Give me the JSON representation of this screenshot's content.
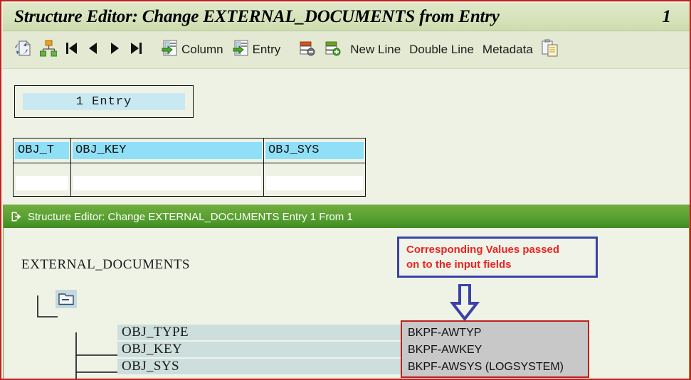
{
  "window": {
    "title": "Structure Editor: Change EXTERNAL_DOCUMENTS from Entry",
    "page_number": "1"
  },
  "toolbar": {
    "items": [
      {
        "icon": "refresh-document-icon",
        "label": ""
      },
      {
        "icon": "hierarchy-icon",
        "label": ""
      },
      {
        "icon": "first-page-icon",
        "label": ""
      },
      {
        "icon": "previous-icon",
        "label": ""
      },
      {
        "icon": "next-icon",
        "label": ""
      },
      {
        "icon": "last-page-icon",
        "label": ""
      },
      {
        "icon": "column-icon",
        "label": "Column"
      },
      {
        "icon": "entry-icon",
        "label": "Entry"
      },
      {
        "icon": "delete-line-icon",
        "label": ""
      },
      {
        "icon": "insert-line-icon",
        "label": ""
      },
      {
        "icon": "",
        "label": "New Line"
      },
      {
        "icon": "",
        "label": "Double Line"
      },
      {
        "icon": "",
        "label": "Metadata"
      },
      {
        "icon": "clipboard-copy-icon",
        "label": ""
      }
    ]
  },
  "entry_box": {
    "value": "1 Entry"
  },
  "columns_table": {
    "headers": [
      "OBJ_T",
      "OBJ_KEY",
      "OBJ_SYS"
    ],
    "values": [
      "",
      "",
      ""
    ]
  },
  "inner_window": {
    "title": "Structure Editor: Change EXTERNAL_DOCUMENTS Entry 1 From 1",
    "title_icon": "structure-editor-icon",
    "tree": {
      "root": "EXTERNAL_DOCUMENTS",
      "folder_icon": "folder-open-icon",
      "fields": [
        "OBJ_TYPE",
        "OBJ_KEY",
        "OBJ_SYS"
      ]
    }
  },
  "annotation": {
    "callout_line1": "Corresponding Values passed",
    "callout_line2": "on to the input fields",
    "arrow_icon": "arrow-down-icon",
    "border_color": "#3b41a8",
    "text_color": "#ee2222"
  },
  "bkpf_box": {
    "border_color": "#c0211d",
    "rows": [
      "BKPF-AWTYP",
      "BKPF-AWKEY",
      "BKPF-AWSYS  (LOGSYSTEM)"
    ]
  }
}
